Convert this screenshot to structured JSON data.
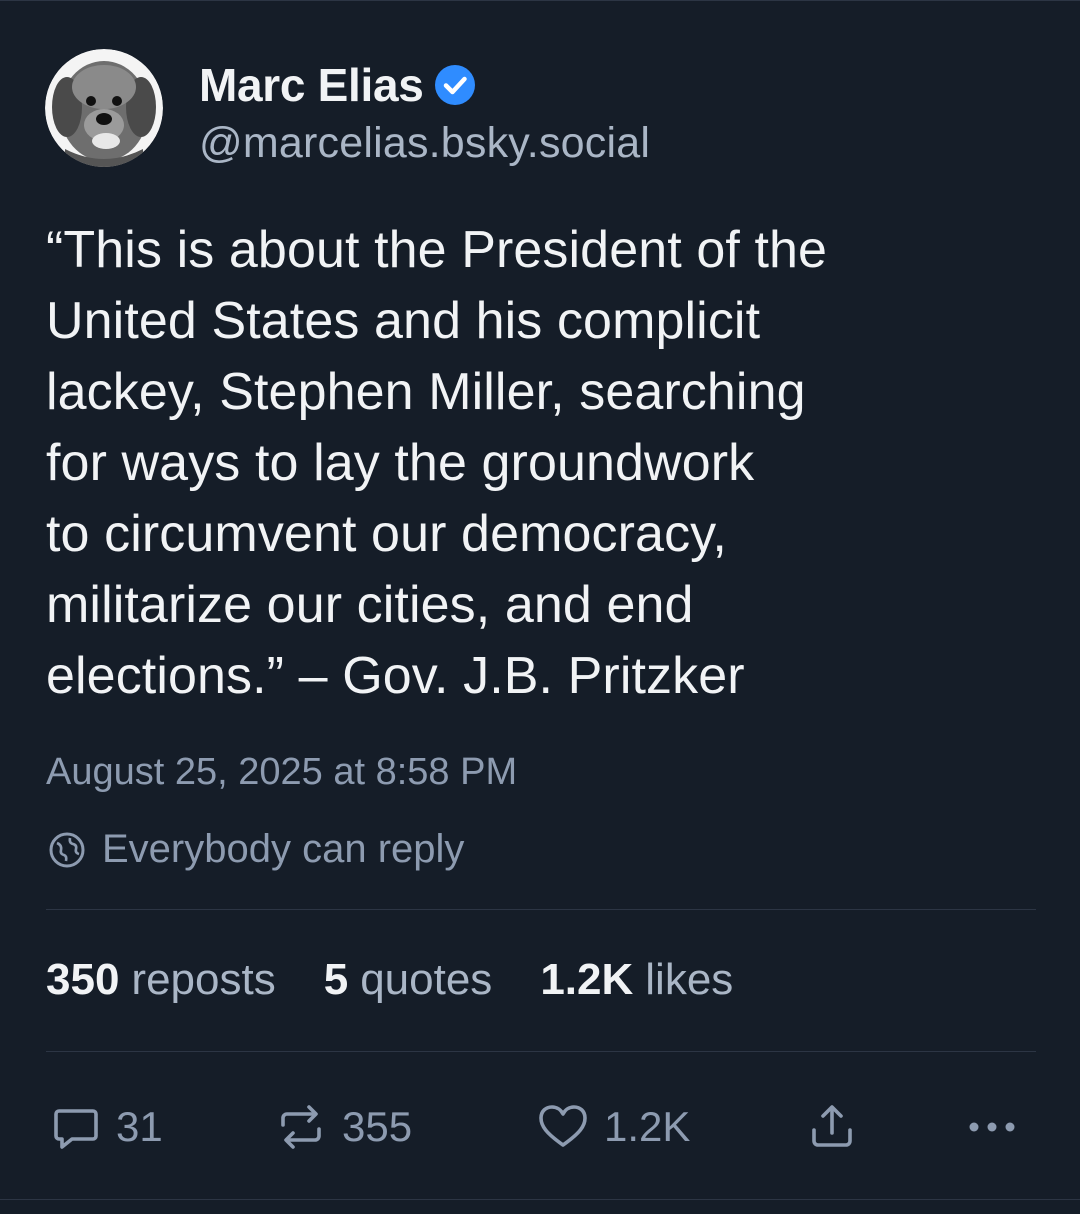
{
  "author": {
    "display_name": "Marc Elias",
    "handle": "@marcelias.bsky.social",
    "verified": true,
    "verified_color": "#2f8cff"
  },
  "post": {
    "text": "“This is about the President of the\nUnited States and his complicit\nlackey, Stephen Miller, searching\nfor ways to lay the groundwork\nto circumvent our democracy,\nmilitarize our cities, and end\nelections.” – Gov. J.B. Pritzker",
    "timestamp": "August 25, 2025 at 8:58 PM",
    "reply_setting": "Everybody can reply"
  },
  "stats": {
    "reposts": {
      "count": "350",
      "label": "reposts"
    },
    "quotes": {
      "count": "5",
      "label": "quotes"
    },
    "likes": {
      "count": "1.2K",
      "label": "likes"
    }
  },
  "actions": {
    "reply_count": "31",
    "repost_count": "355",
    "like_count": "1.2K",
    "icons": [
      "reply-icon",
      "repost-icon",
      "heart-icon",
      "share-icon",
      "more-icon"
    ]
  },
  "colors": {
    "background": "#151d28",
    "text": "#f1f3f5",
    "muted": "#8d9bb0",
    "divider": "#2c3544"
  }
}
